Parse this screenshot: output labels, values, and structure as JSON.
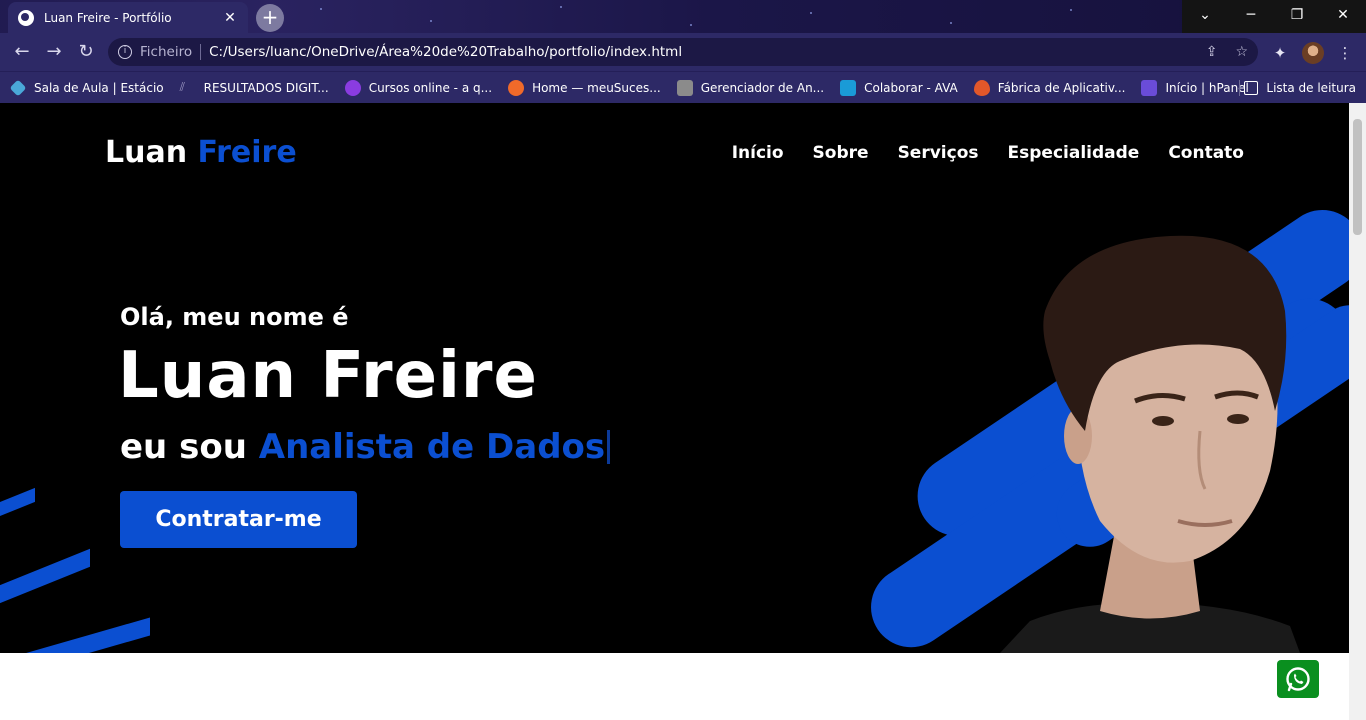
{
  "browser": {
    "tab_title": "Luan Freire - Portfólio",
    "address_scheme": "Ficheiro",
    "address_url": "C:/Users/luanc/OneDrive/Área%20de%20Trabalho/portfolio/index.html",
    "bookmarks": [
      {
        "label": "Sala de Aula | Estácio",
        "color": "#4aa8d8"
      },
      {
        "label": "RESULTADOS DIGIT...",
        "color": "#9a96c0"
      },
      {
        "label": "Cursos online - a q...",
        "color": "#8a3ce0"
      },
      {
        "label": "Home — meuSuces...",
        "color": "#f06a2a"
      },
      {
        "label": "Gerenciador de An...",
        "color": "#8b8b8b"
      },
      {
        "label": "Colaborar - AVA",
        "color": "#1a9bd7"
      },
      {
        "label": "Fábrica de Aplicativ...",
        "color": "#e2572a"
      },
      {
        "label": "Início | hPanel",
        "color": "#6a4cd8"
      }
    ],
    "reading_list": "Lista de leitura"
  },
  "page": {
    "logo_first": "Luan",
    "logo_second": "Freire",
    "nav": [
      "Início",
      "Sobre",
      "Serviços",
      "Especialidade",
      "Contato"
    ],
    "greeting": "Olá, meu nome é",
    "name": "Luan Freire",
    "role_prefix": "eu sou",
    "role_value": "Analista de Dados",
    "cta_label": "Contratar-me"
  },
  "colors": {
    "accent": "#0b4fd1",
    "hero_bg": "#000000",
    "whatsapp": "#0a8f1f"
  }
}
